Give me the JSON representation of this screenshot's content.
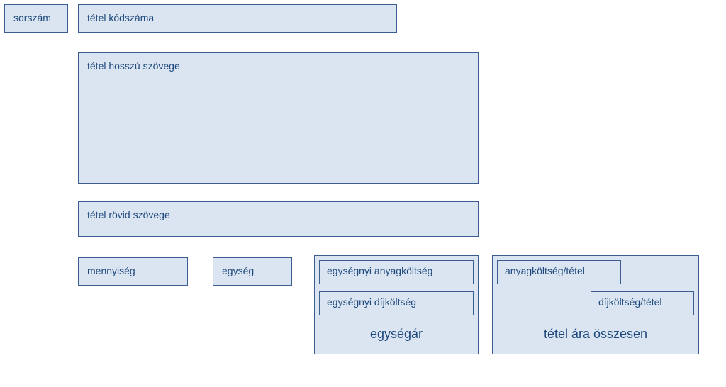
{
  "fields": {
    "serial": "sorszám",
    "item_code": "tétel kódszáma",
    "item_long_text": "tétel hosszú szövege",
    "item_short_text": "tétel rövid szövege",
    "quantity": "mennyiség",
    "unit": "egység"
  },
  "unit_price_group": {
    "material_cost_per_unit": "egységnyi anyagköltség",
    "labor_cost_per_unit": "egységnyi díjköltség",
    "label": "egységár"
  },
  "item_total_group": {
    "material_cost_per_item": "anyagköltség/tétel",
    "labor_cost_per_item": "díjköltség/tétel",
    "label": "tétel ára összesen"
  }
}
